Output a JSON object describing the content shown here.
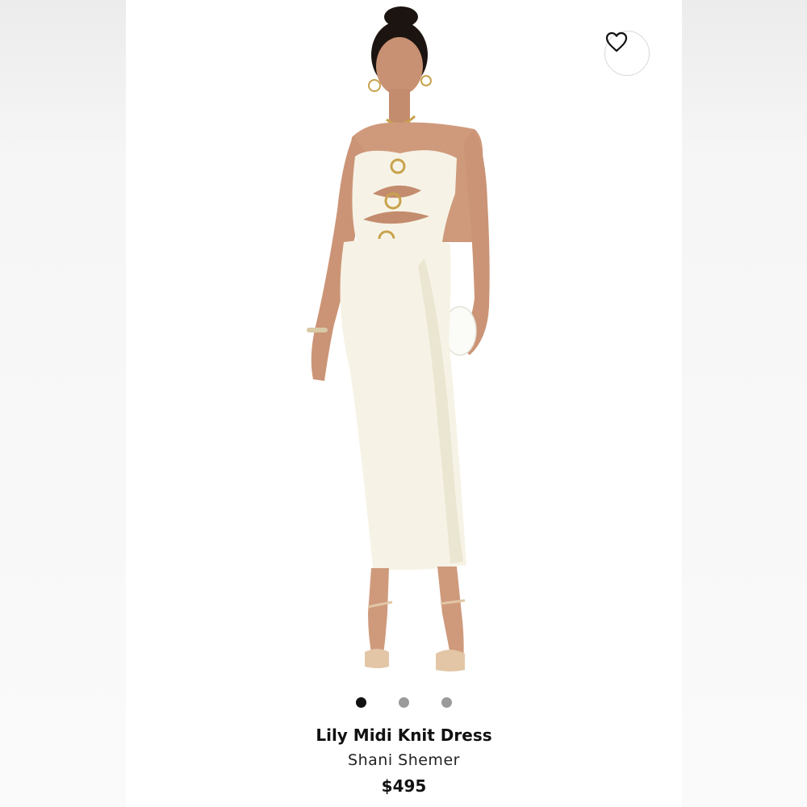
{
  "product": {
    "name": "Lily Midi Knit Dress",
    "brand": "Shani Shemer",
    "price": "$495",
    "image_alt": "Model wearing ivory strapless midi dress with gold ring cutouts"
  },
  "gallery": {
    "total_images": 3,
    "active_index": 0
  },
  "wishlist": {
    "icon": "heart-outline-icon"
  },
  "colors": {
    "dot_active": "#111111",
    "dot_inactive": "#9a9a9a",
    "dress": "#f6f3e6",
    "skin": "#d9a98a"
  }
}
